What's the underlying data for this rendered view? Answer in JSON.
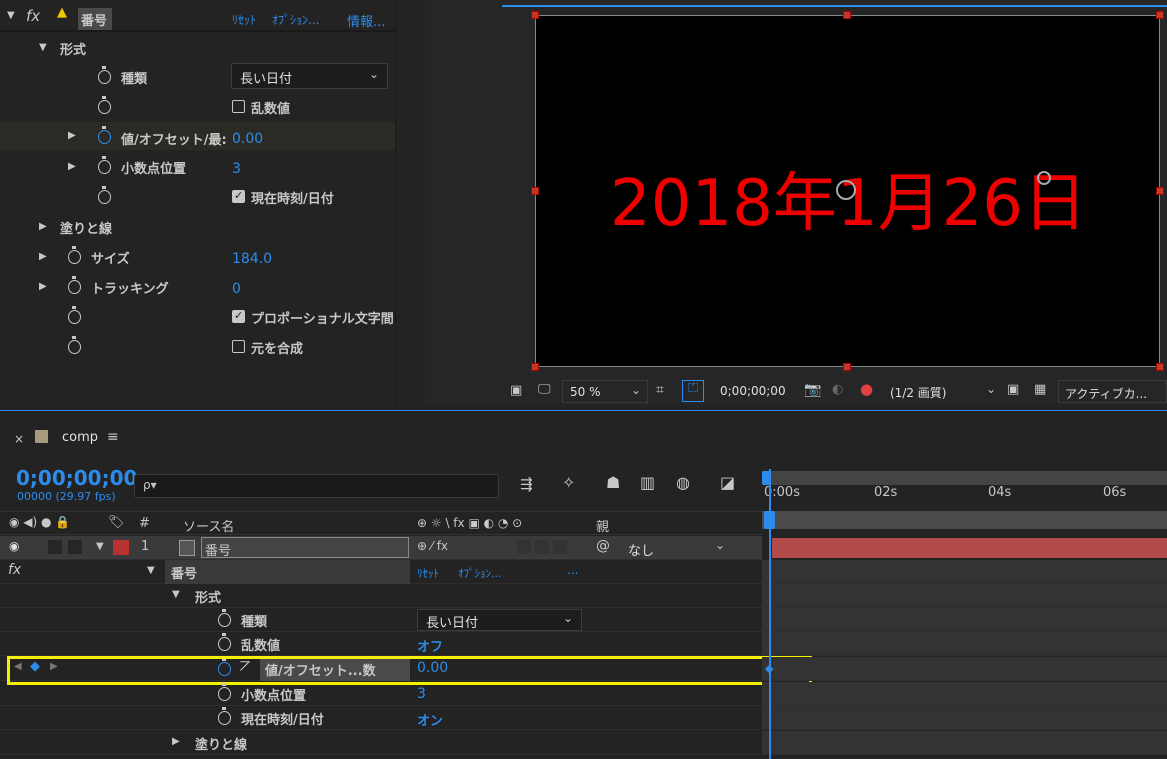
{
  "effect_panel": {
    "fx_label": "fx",
    "effect_name": "番号",
    "reset_label": "ﾘｾｯﾄ",
    "options_label": "ｵﾌﾟｼｮﾝ...",
    "about_label": "情報...",
    "rows": {
      "format": "形式",
      "type": "種類",
      "type_value": "長い日付",
      "random_label": "乱数値",
      "value_offset": "値/オフセット/最:",
      "value_offset_value": "0.00",
      "decimal": "小数点位置",
      "decimal_value": "3",
      "current_time": "現在時刻/日付",
      "fill_stroke": "塗りと線",
      "size": "サイズ",
      "size_value": "184.0",
      "tracking": "トラッキング",
      "tracking_value": "0",
      "proportional": "プロポーショナル文字間",
      "composite": "元を合成"
    }
  },
  "composition_view": {
    "canvas_text": "2018年1月26日",
    "text_color": "#e60000",
    "zoom": "50 %",
    "timecode": "0;00;00;00",
    "resolution": "(1/2 画質)",
    "camera": "アクティブカ..."
  },
  "timeline": {
    "close": "×",
    "comp_name": "comp",
    "menu_icon": "≡",
    "timecode": "0;00;00;00",
    "frames": "00000 (29.97 fps)",
    "search_placeholder": "ρ▾",
    "col_number": "#",
    "col_source": "ソース名",
    "col_switches": "⊕ ☼ \\ fx ▣ ◐ ◔ ⊙",
    "col_parent": "親",
    "layer_number": "1",
    "layer_name": "番号",
    "parent_value": "なし",
    "ruler": [
      "0:00s",
      "02s",
      "04s",
      "06s"
    ],
    "props": {
      "effect": "番号",
      "reset": "ﾘｾｯﾄ",
      "options": "ｵﾌﾟｼｮﾝ...",
      "dots": "...",
      "format": "形式",
      "type": "種類",
      "type_value": "長い日付",
      "random": "乱数値",
      "random_value": "オフ",
      "value_offset": "値/オフセット...数",
      "value_offset_value": "0.00",
      "decimal": "小数点位置",
      "decimal_value": "3",
      "current_time": "現在時刻/日付",
      "current_time_value": "オン",
      "fill_stroke": "塗りと線"
    }
  },
  "colors": {
    "accent": "#2d8ceb",
    "highlight": "#f5f000",
    "layer_bar": "#b34a4a",
    "label_red": "#b83232"
  }
}
